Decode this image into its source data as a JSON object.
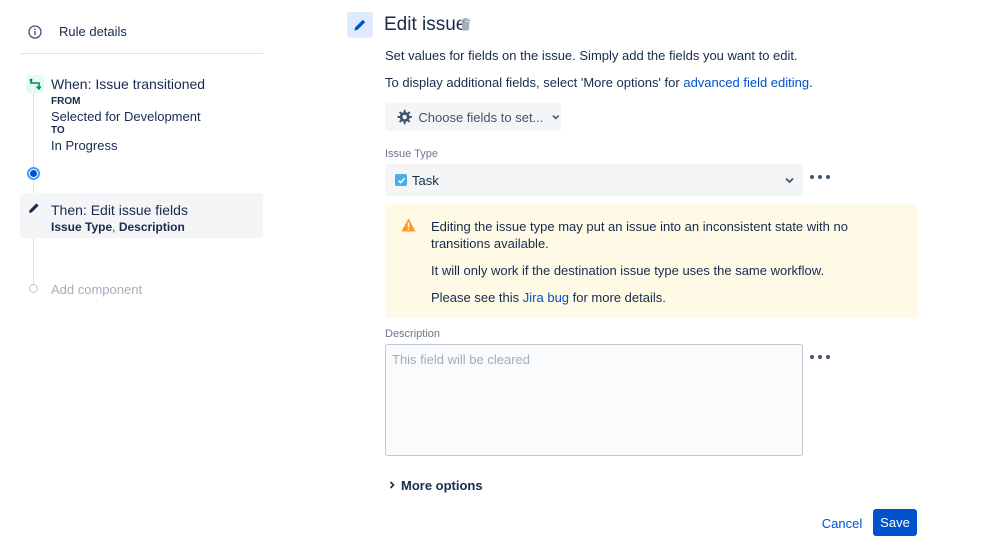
{
  "sidebar": {
    "rule_details": {
      "label": "Rule details",
      "icon": "info-icon"
    },
    "trigger": {
      "title": "When: Issue transitioned",
      "from_label": "FROM",
      "from_value": "Selected for Development",
      "to_label": "TO",
      "to_value": "In Progress",
      "icon": "transition-icon",
      "icon_color": "#00875a"
    },
    "action": {
      "title": "Then: Edit issue fields",
      "field1": "Issue Type",
      "separator": ", ",
      "field2": "Description",
      "icon": "pencil-icon"
    },
    "add_component": {
      "label": "Add component"
    }
  },
  "main": {
    "title": "Edit issue",
    "description_line1": "Set values for fields on the issue. Simply add the fields you want to edit.",
    "description_line2_prefix": "To display additional fields, select 'More options' for ",
    "description_line2_link": "advanced field editing",
    "description_line2_suffix": ".",
    "choose_fields_label": "Choose fields to set...",
    "issue_type": {
      "label": "Issue Type",
      "value": "Task"
    },
    "warning": {
      "line1": "Editing the issue type may put an issue into an inconsistent state with no transitions available.",
      "line2": "It will only work if the destination issue type uses the same workflow.",
      "line3_prefix": "Please see this ",
      "line3_link": "Jira bug",
      "line3_suffix": " for more details.",
      "color": "#fffae6",
      "icon_color": "#ff991f"
    },
    "description_field": {
      "label": "Description",
      "placeholder": "This field will be cleared",
      "value": ""
    },
    "more_options_label": "More options",
    "cancel_label": "Cancel",
    "save_label": "Save"
  },
  "colors": {
    "accent": "#0052cc",
    "text": "#172b4d",
    "subtle_text": "#6b778c"
  }
}
